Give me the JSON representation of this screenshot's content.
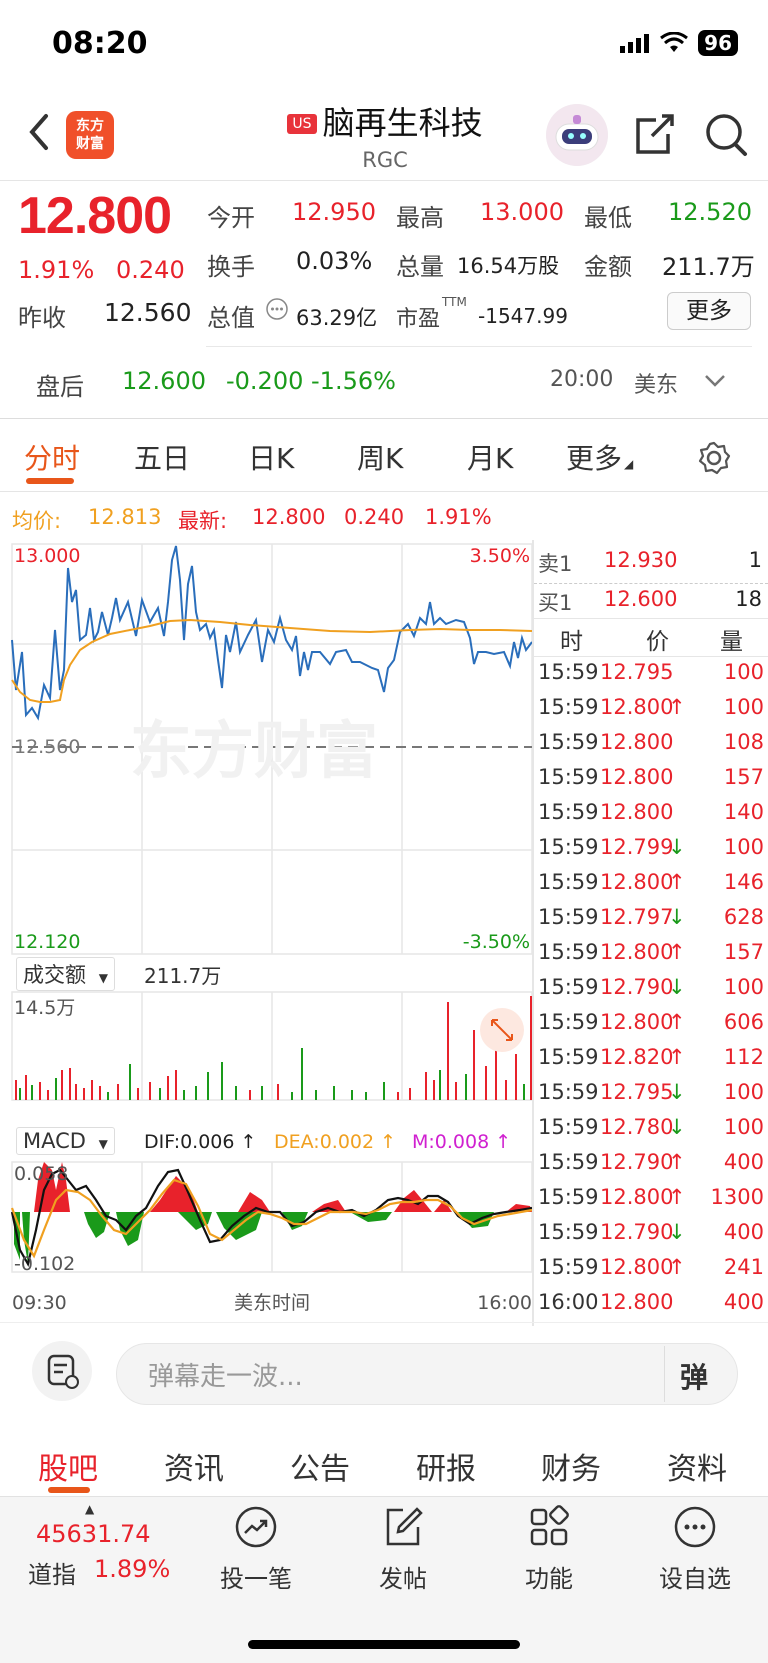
{
  "status": {
    "time": "08:20",
    "battery": "96"
  },
  "header": {
    "logo_text": "东方财富",
    "market_badge": "US",
    "name": "脑再生科技",
    "code": "RGC"
  },
  "quote": {
    "price": "12.800",
    "change_pct": "1.91%",
    "change_amt": "0.240",
    "prev_close_label": "昨收",
    "prev_close": "12.560",
    "open_label": "今开",
    "open": "12.950",
    "high_label": "最高",
    "high": "13.000",
    "low_label": "最低",
    "low": "12.520",
    "turnover_label": "换手",
    "turnover": "0.03%",
    "volume_label": "总量",
    "volume": "16.54万股",
    "amount_label": "金额",
    "amount": "211.7万",
    "mktcap_label": "总值",
    "mktcap": "63.29亿",
    "pe_label": "市盈",
    "pe_sup": "TTM",
    "pe": "-1547.99",
    "more_label": "更多"
  },
  "after_hours": {
    "label": "盘后",
    "price": "12.600",
    "change": "-0.200",
    "change_pct": "-1.56%",
    "time": "20:00",
    "zone": "美东"
  },
  "period_tabs": [
    "分时",
    "五日",
    "日K",
    "周K",
    "月K",
    "更多"
  ],
  "summary": {
    "avg_label": "均价:",
    "avg": "12.813",
    "last_label": "最新:",
    "last": "12.800",
    "last_chg": "0.240",
    "last_pct": "1.91%"
  },
  "intraday_axis": {
    "top": "13.000",
    "mid": "12.560",
    "bottom": "12.120",
    "top_pct": "3.50%",
    "bottom_pct": "-3.50%",
    "watermark": "东方财富"
  },
  "volume_panel": {
    "selector": "成交额",
    "total": "211.7万",
    "max": "14.5万"
  },
  "macd_panel": {
    "selector": "MACD",
    "dif": "DIF:0.006 ↑",
    "dea": "DEA:0.002 ↑",
    "m": "M:0.008 ↑",
    "top": "0.058",
    "bottom": "-0.102",
    "start": "09:30",
    "mid": "美东时间",
    "end": "16:00"
  },
  "order_book": {
    "ask_label": "卖1",
    "ask_price": "12.930",
    "ask_qty": "1",
    "bid_label": "买1",
    "bid_price": "12.600",
    "bid_qty": "18",
    "col_time": "时",
    "col_price": "价",
    "col_qty": "量"
  },
  "ticks": [
    {
      "time": "15:59",
      "price": "12.795",
      "dir": "",
      "qty": "100"
    },
    {
      "time": "15:59",
      "price": "12.800",
      "dir": "↑",
      "qty": "100"
    },
    {
      "time": "15:59",
      "price": "12.800",
      "dir": "",
      "qty": "108"
    },
    {
      "time": "15:59",
      "price": "12.800",
      "dir": "",
      "qty": "157"
    },
    {
      "time": "15:59",
      "price": "12.800",
      "dir": "",
      "qty": "140"
    },
    {
      "time": "15:59",
      "price": "12.799",
      "dir": "↓",
      "qty": "100"
    },
    {
      "time": "15:59",
      "price": "12.800",
      "dir": "↑",
      "qty": "146"
    },
    {
      "time": "15:59",
      "price": "12.797",
      "dir": "↓",
      "qty": "628"
    },
    {
      "time": "15:59",
      "price": "12.800",
      "dir": "↑",
      "qty": "157"
    },
    {
      "time": "15:59",
      "price": "12.790",
      "dir": "↓",
      "qty": "100"
    },
    {
      "time": "15:59",
      "price": "12.800",
      "dir": "↑",
      "qty": "606"
    },
    {
      "time": "15:59",
      "price": "12.820",
      "dir": "↑",
      "qty": "112"
    },
    {
      "time": "15:59",
      "price": "12.795",
      "dir": "↓",
      "qty": "100"
    },
    {
      "time": "15:59",
      "price": "12.780",
      "dir": "↓",
      "qty": "100"
    },
    {
      "time": "15:59",
      "price": "12.790",
      "dir": "↑",
      "qty": "400"
    },
    {
      "time": "15:59",
      "price": "12.800",
      "dir": "↑",
      "qty": "1300"
    },
    {
      "time": "15:59",
      "price": "12.790",
      "dir": "↓",
      "qty": "400"
    },
    {
      "time": "15:59",
      "price": "12.800",
      "dir": "↑",
      "qty": "241"
    },
    {
      "time": "16:00",
      "price": "12.800",
      "dir": "",
      "qty": "400"
    }
  ],
  "danmu": {
    "placeholder": "弹幕走一波...",
    "button": "弹"
  },
  "section_tabs": [
    "股吧",
    "资讯",
    "公告",
    "研报",
    "财务",
    "资料"
  ],
  "bottom_bar": {
    "index_value": "45631.74",
    "index_name": "道指",
    "index_pct": "1.89%",
    "items": [
      "投一笔",
      "发帖",
      "功能",
      "设自选"
    ]
  },
  "colors": {
    "up": "#e8222b",
    "down": "#1a9a1a",
    "accent": "#e8561a",
    "avg_line": "#f0a020",
    "price_line": "#2a6ebb"
  }
}
